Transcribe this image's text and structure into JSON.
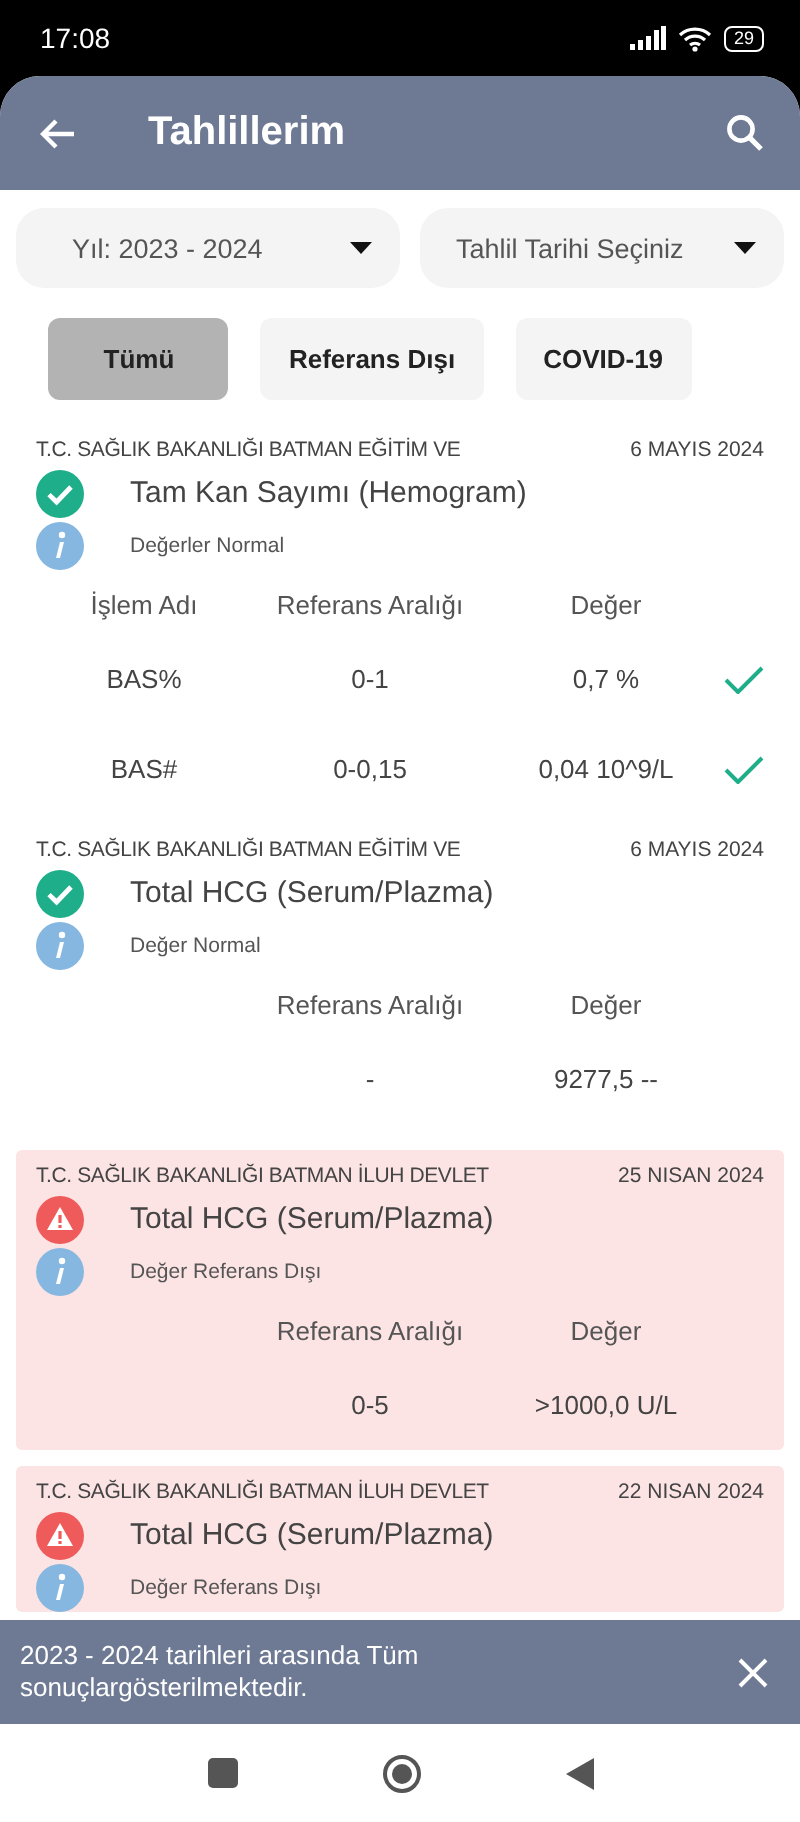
{
  "status_bar": {
    "time": "17:08",
    "battery": "29"
  },
  "header": {
    "title": "Tahlillerim"
  },
  "filters": [
    {
      "value": "Yıl: 2023 - 2024"
    },
    {
      "value": "Tahlil Tarihi Seçiniz"
    }
  ],
  "chips": [
    {
      "label": "Tümü",
      "selected": true
    },
    {
      "label": "Referans Dışı",
      "selected": false
    },
    {
      "label": "COVID-19",
      "selected": false
    }
  ],
  "results": [
    {
      "kind": "normal",
      "institution": "T.C. SAĞLIK BAKANLIĞI BATMAN EĞİTİM VE",
      "date": "6 MAYIS 2024",
      "test": "Tam Kan Sayımı (Hemogram)",
      "note": "Değerler Normal",
      "columns": [
        {
          "kind": "name",
          "label": "İşlem Adı"
        },
        {
          "kind": "range",
          "label": "Referans Aralığı"
        },
        {
          "kind": "value",
          "label": "Değer"
        }
      ],
      "rows": [
        {
          "name": "BAS%",
          "range": "0-1",
          "value": "0,7 %",
          "in_range": true
        },
        {
          "name": "BAS#",
          "range": "0-0,15",
          "value": "0,04 10^9/L",
          "in_range": true
        }
      ]
    },
    {
      "kind": "normal",
      "institution": "T.C. SAĞLIK BAKANLIĞI BATMAN EĞİTİM VE",
      "date": "6 MAYIS 2024",
      "test": "Total HCG (Serum/Plazma)",
      "note": "Değer Normal",
      "columns": [
        {
          "kind": "range",
          "label": "Referans Aralığı"
        },
        {
          "kind": "value",
          "label": "Değer"
        }
      ],
      "rows": [
        {
          "range": "-",
          "value": "9277,5 --",
          "in_range": false
        }
      ]
    },
    {
      "kind": "abnormal",
      "institution": "T.C. SAĞLIK BAKANLIĞI BATMAN İLUH DEVLET",
      "date": "25 NISAN 2024",
      "test": "Total HCG (Serum/Plazma)",
      "note": "Değer Referans Dışı",
      "columns": [
        {
          "kind": "range",
          "label": "Referans Aralığı"
        },
        {
          "kind": "value",
          "label": "Değer"
        }
      ],
      "rows": [
        {
          "range": "0-5",
          "value": ">1000,0 U/L",
          "in_range": false
        }
      ]
    },
    {
      "kind": "abnormal",
      "institution": "T.C. SAĞLIK BAKANLIĞI BATMAN İLUH DEVLET",
      "date": "22 NISAN 2024",
      "test": "Total HCG (Serum/Plazma)",
      "note": "Değer Referans Dışı"
    }
  ],
  "snackbar": {
    "message": "2023 - 2024 tarihleri arasında Tüm sonuçlargösterilmektedir."
  }
}
